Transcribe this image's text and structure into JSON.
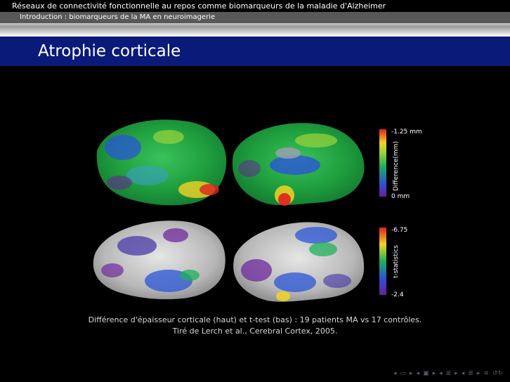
{
  "header": {
    "title": "Réseaux de connectivité fonctionnelle au repos comme biomarqueurs de la maladie d'Alzheimer",
    "section": "Introduction : biomarqueurs de la MA en neuroimagerie"
  },
  "slide": {
    "title": "Atrophie corticale"
  },
  "figure": {
    "top_scale": {
      "max": "-1.25 mm",
      "axis": "Difference(mm)",
      "min": "0 mm"
    },
    "bottom_scale": {
      "max": "-6.75",
      "axis": "t-statistics",
      "min": "-2.4"
    }
  },
  "caption": {
    "line1": "Différence d'épaisseur corticale (haut) et t-test (bas) : 19 patients MA vs 17 contrôles.",
    "line2": "Tiré de Lerch et al., Cerebral Cortex, 2005."
  },
  "nav": {
    "icons": [
      "first-frame",
      "frame",
      "next-frame",
      "prev-subsection",
      "subsection",
      "next-subsection",
      "prev-section",
      "section",
      "next-section",
      "prev-slide",
      "slide",
      "next-slide",
      "align",
      "search"
    ],
    "glyphs": [
      "◂",
      "▭",
      "▸",
      "◂",
      "▣",
      "▸",
      "◂",
      "≣",
      "▸",
      "◂",
      "≣",
      "▸",
      "≡",
      "↺↻"
    ]
  }
}
